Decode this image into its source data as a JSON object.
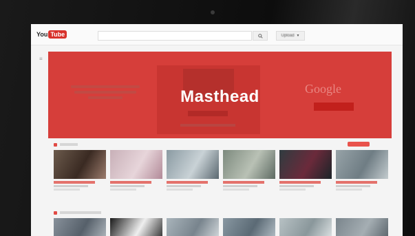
{
  "app": {
    "logo_you": "You",
    "logo_tube": "Tube",
    "search_button_icon": "search-icon",
    "upload_label": "Upload",
    "upload_icon": "chevron-down-icon"
  },
  "masthead": {
    "title": "Masthead",
    "brand": "Google",
    "colors": {
      "banner": "#d63e3a",
      "cta": "#c2201c"
    }
  },
  "rows": [
    {
      "videos": [
        {
          "colors": [
            "#6b5a4c",
            "#3a2a22",
            "#9b7b6c"
          ]
        },
        {
          "colors": [
            "#c8b0b8",
            "#e7d5da",
            "#b28a98"
          ]
        },
        {
          "colors": [
            "#8a9aa2",
            "#c9d2d6",
            "#5b6870"
          ]
        },
        {
          "colors": [
            "#7d8a7e",
            "#b9c1b5",
            "#5d6a62"
          ]
        },
        {
          "colors": [
            "#2f3c40",
            "#6b2a3b",
            "#1b2428"
          ]
        },
        {
          "colors": [
            "#97a3a8",
            "#6f7d84",
            "#c3cbce"
          ]
        }
      ]
    },
    {
      "videos": [
        {
          "colors": [
            "#87909a",
            "#56606a",
            "#b1b8be"
          ]
        },
        {
          "colors": [
            "#1a1a1a",
            "#efefef",
            "#2d2d2d"
          ]
        },
        {
          "colors": [
            "#a9b4bb",
            "#78848d",
            "#d6dbde"
          ]
        },
        {
          "colors": [
            "#8897a1",
            "#5b6a75",
            "#b5c0c7"
          ]
        },
        {
          "colors": [
            "#b7c1c4",
            "#8a979b",
            "#dfe4e5"
          ]
        },
        {
          "colors": [
            "#7a858c",
            "#a5aeb3",
            "#59636a"
          ]
        }
      ]
    }
  ]
}
